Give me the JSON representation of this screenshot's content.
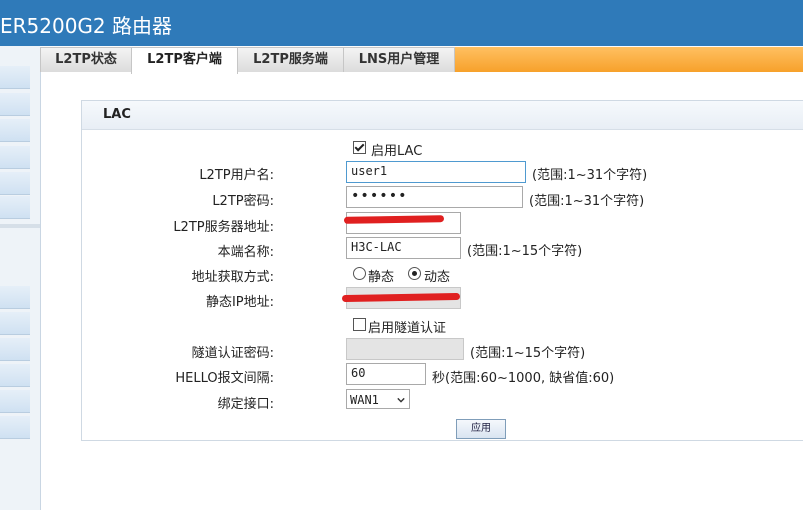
{
  "header": {
    "title": "ER5200G2 路由器"
  },
  "tabs": [
    {
      "label": "L2TP状态",
      "active": false
    },
    {
      "label": "L2TP客户端",
      "active": true
    },
    {
      "label": "L2TP服务端",
      "active": false
    },
    {
      "label": "LNS用户管理",
      "active": false
    }
  ],
  "panel": {
    "title": "LAC"
  },
  "form": {
    "enable_lac": {
      "label": "启用LAC",
      "checked": true
    },
    "username": {
      "label": "L2TP用户名:",
      "value": "user1",
      "hint": "(范围:1~31个字符)"
    },
    "password": {
      "label": "L2TP密码:",
      "value": "••••••",
      "hint": "(范围:1~31个字符)"
    },
    "server_address": {
      "label": "L2TP服务器地址:",
      "value": ""
    },
    "local_name": {
      "label": "本端名称:",
      "value": "H3C-LAC",
      "hint": "(范围:1~15个字符)"
    },
    "addr_mode": {
      "label": "地址获取方式:",
      "options": [
        "静态",
        "动态"
      ],
      "selected": "动态"
    },
    "static_ip": {
      "label": "静态IP地址:",
      "value": ""
    },
    "enable_tunnel_auth": {
      "label": "启用隧道认证",
      "checked": false
    },
    "tunnel_password": {
      "label": "隧道认证密码:",
      "value": "",
      "hint": "(范围:1~15个字符)"
    },
    "hello_interval": {
      "label": "HELLO报文间隔:",
      "value": "60",
      "hint": "秒(范围:60~1000, 缺省值:60)"
    },
    "bind_interface": {
      "label": "绑定接口:",
      "selected": "WAN1"
    },
    "apply_label": "应用"
  },
  "colors": {
    "header": "#2f7ab9",
    "tab_accent": "#f7a12b",
    "redaction": "#e02020"
  }
}
